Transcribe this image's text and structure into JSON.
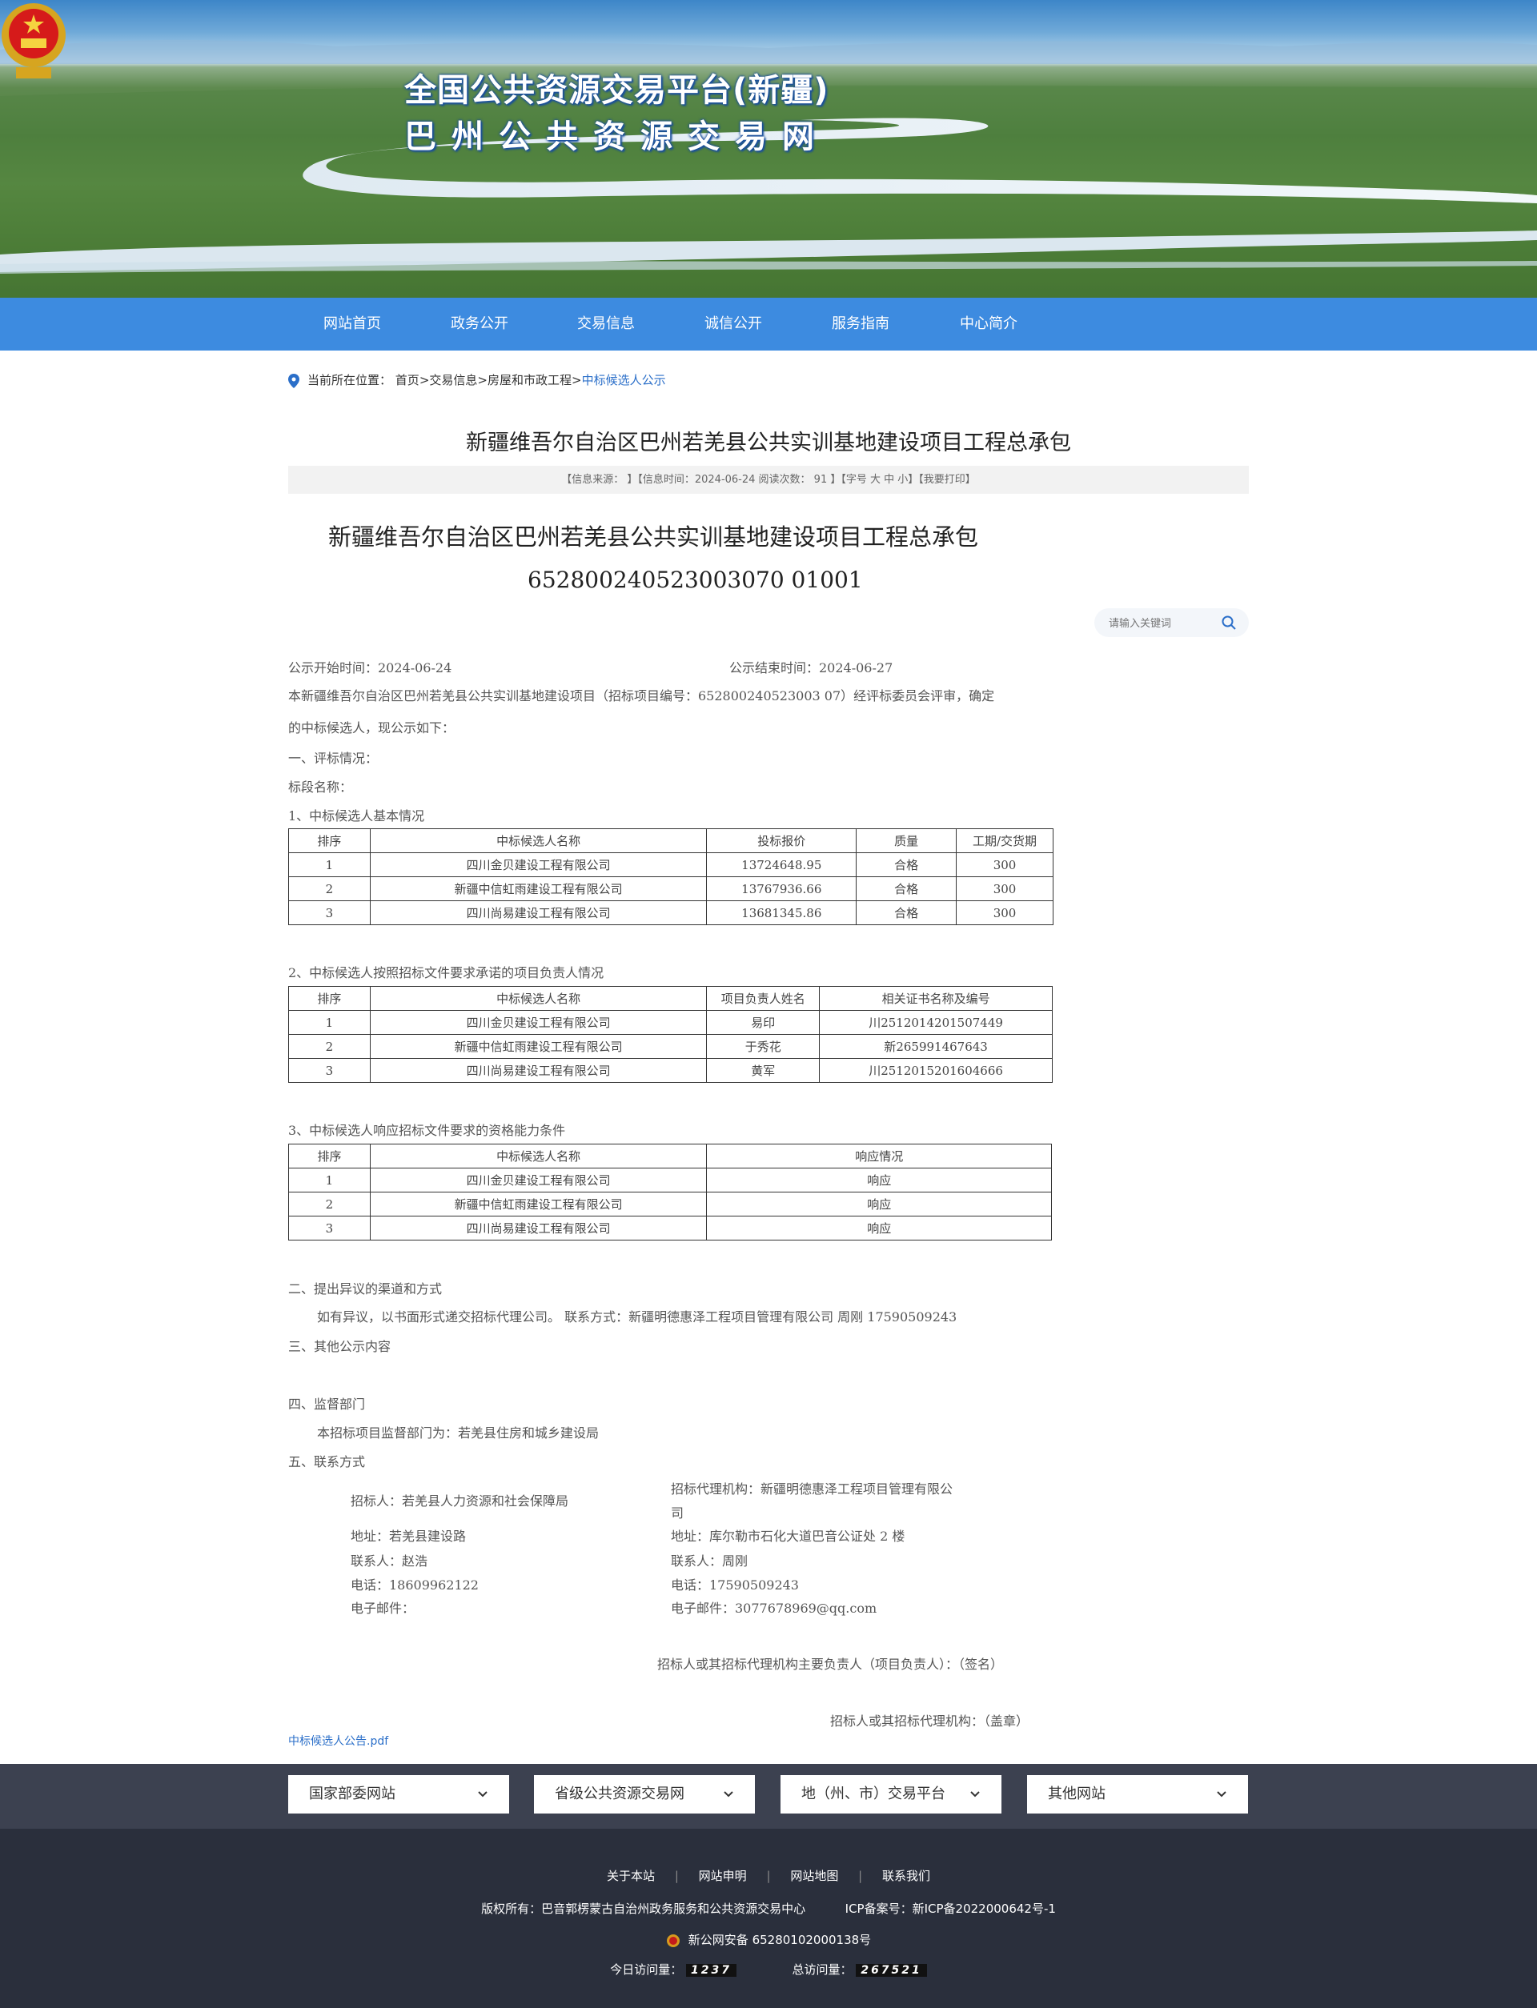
{
  "header": {
    "title_line1": "全国公共资源交易平台(新疆)",
    "title_line2": "巴州公共资源交易网"
  },
  "nav": {
    "items": [
      "网站首页",
      "政务公开",
      "交易信息",
      "诚信公开",
      "服务指南",
      "中心简介"
    ],
    "search_placeholder": "请输入关键词"
  },
  "breadcrumb": {
    "prefix": "当前所在位置：",
    "home": "首页",
    "sep": ">",
    "l1": "交易信息",
    "l2": "房屋和市政工程",
    "current": "中标候选人公示"
  },
  "article": {
    "title": "新疆维吾尔自治区巴州若羌县公共实训基地建设项目工程总承包",
    "meta": "【信息来源： 】【信息时间：2024-06-24  阅读次数： 91 】【字号 大 中 小】【我要打印】",
    "heading1": "新疆维吾尔自治区巴州若羌县公共实训基地建设项目工程总承包",
    "heading2": "652800240523003070 01001",
    "start_time": "公示开始时间：2024-06-24",
    "end_time": "公示结束时间：2024-06-27",
    "intro1": "本新疆维吾尔自治区巴州若羌县公共实训基地建设项目（招标项目编号：652800240523003 07）经评标委员会评审，确定",
    "intro2": "的中标候选人，现公示如下：",
    "s1": "一、评标情况：",
    "s1_sub": "标段名称：",
    "t1_title": "1、中标候选人基本情况",
    "t1_headers": [
      "排序",
      "中标候选人名称",
      "投标报价",
      "质量",
      "工期/交货期"
    ],
    "t1_rows": [
      [
        "1",
        "四川金贝建设工程有限公司",
        "13724648.95",
        "合格",
        "300"
      ],
      [
        "2",
        "新疆中信虹雨建设工程有限公司",
        "13767936.66",
        "合格",
        "300"
      ],
      [
        "3",
        "四川尚易建设工程有限公司",
        "13681345.86",
        "合格",
        "300"
      ]
    ],
    "t2_title": "2、中标候选人按照招标文件要求承诺的项目负责人情况",
    "t2_headers": [
      "排序",
      "中标候选人名称",
      "项目负责人姓名",
      "相关证书名称及编号"
    ],
    "t2_rows": [
      [
        "1",
        "四川金贝建设工程有限公司",
        "易印",
        "川2512014201507449"
      ],
      [
        "2",
        "新疆中信虹雨建设工程有限公司",
        "于秀花",
        "新265991467643"
      ],
      [
        "3",
        "四川尚易建设工程有限公司",
        "黄军",
        "川2512015201604666"
      ]
    ],
    "t3_title": "3、中标候选人响应招标文件要求的资格能力条件",
    "t3_headers": [
      "排序",
      "中标候选人名称",
      "响应情况"
    ],
    "t3_rows": [
      [
        "1",
        "四川金贝建设工程有限公司",
        "响应"
      ],
      [
        "2",
        "新疆中信虹雨建设工程有限公司",
        "响应"
      ],
      [
        "3",
        "四川尚易建设工程有限公司",
        "响应"
      ]
    ],
    "s2": "二、提出异议的渠道和方式",
    "s2_text": "如有异议，以书面形式递交招标代理公司。 联系方式：新疆明德惠泽工程项目管理有限公司 周刚 17590509243",
    "s3": "三、其他公示内容",
    "s4": "四、监督部门",
    "s4_text": "本招标项目监督部门为：若羌县住房和城乡建设局",
    "s5": "五、联系方式",
    "c_left": {
      "tenderer": "招标人：若羌县人力资源和社会保障局",
      "address": "地址：若羌县建设路",
      "contact": "联系人：赵浩",
      "phone": "电话：18609962122",
      "email": "电子邮件："
    },
    "c_right": {
      "agency1": "招标代理机构：新疆明德惠泽工程项目管理有限公",
      "agency2": "司",
      "address": "地址：库尔勒市石化大道巴音公证处 2 楼",
      "contact": "联系人：周刚",
      "phone": "电话：17590509243",
      "email": "电子邮件：3077678969@qq.com"
    },
    "sign1": "招标人或其招标代理机构主要负责人（项目负责人）：（签名）",
    "sign2": "招标人或其招标代理机构：（盖章）",
    "attachment": "中标候选人公告.pdf"
  },
  "footer": {
    "selects": [
      "国家部委网站",
      "省级公共资源交易网",
      "地（州、市）交易平台",
      "其他网站"
    ],
    "links": [
      "关于本站",
      "网站申明",
      "网站地图",
      "联系我们"
    ],
    "copyright": "版权所有：巴音郭楞蒙古自治州政务服务和公共资源交易中心",
    "icp": "ICP备案号：新ICP备2022000642号-1",
    "police": "新公网安备 65280102000138号",
    "today_label": "今日访问量：",
    "today_value": "1237",
    "total_label": "总访问量：",
    "total_value": "267521"
  },
  "colors": {
    "nav_bg": "#3d8be0",
    "link_blue": "#2b6fc9",
    "footer_dark": "#2a2f3c",
    "footer_bar": "#3c4150"
  }
}
